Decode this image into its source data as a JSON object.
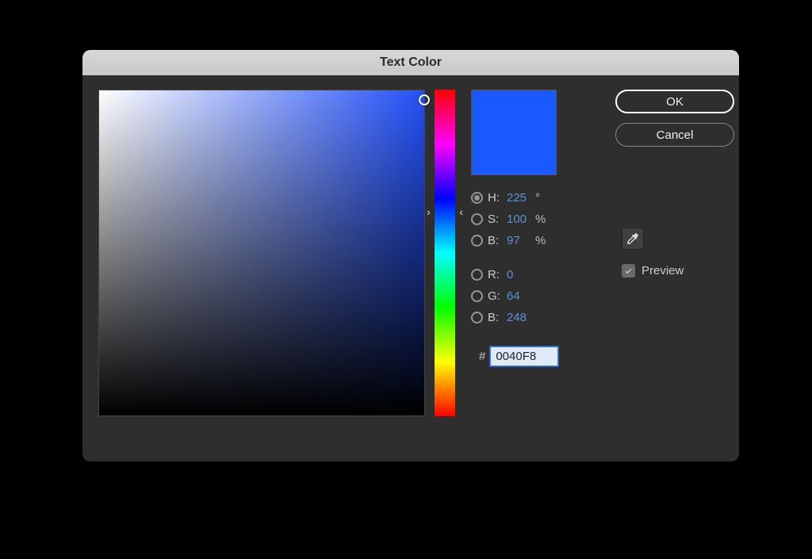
{
  "window": {
    "title": "Text Color"
  },
  "swatch_color": "#1a59ff",
  "hsb": {
    "h_label": "H:",
    "h_value": "225",
    "h_unit": "°",
    "s_label": "S:",
    "s_value": "100",
    "s_unit": "%",
    "b_label": "B:",
    "b_value": "97",
    "b_unit": "%"
  },
  "rgb": {
    "r_label": "R:",
    "r_value": "0",
    "g_label": "G:",
    "g_value": "64",
    "b_label": "B:",
    "b_value": "248"
  },
  "hex": {
    "hash": "#",
    "value": "0040F8"
  },
  "buttons": {
    "ok": "OK",
    "cancel": "Cancel"
  },
  "preview": {
    "label": "Preview",
    "checked": true
  }
}
